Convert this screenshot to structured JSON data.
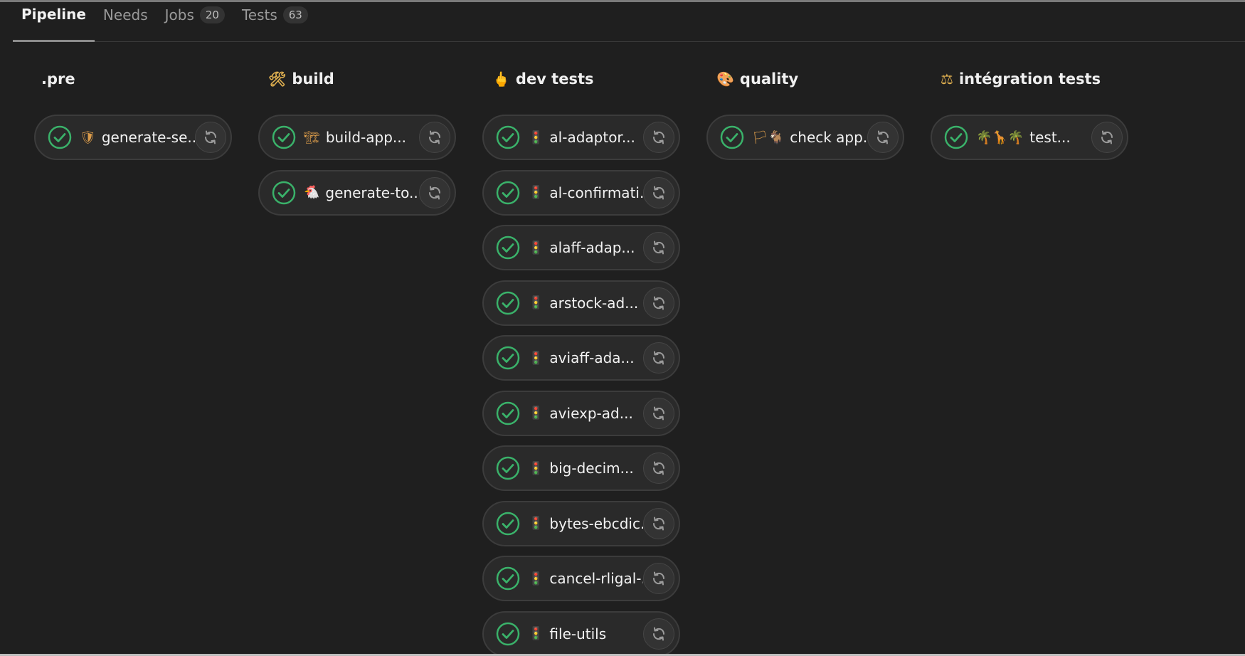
{
  "tabs": [
    {
      "label": "Pipeline",
      "count": ""
    },
    {
      "label": "Needs",
      "count": ""
    },
    {
      "label": "Jobs",
      "count": "20"
    },
    {
      "label": "Tests",
      "count": "63"
    }
  ],
  "colors": {
    "success": "#3ab26a",
    "background": "#1f1f1f",
    "job_pill": "#2a2a2a"
  },
  "icons": {
    "status": "check-circle-icon",
    "retry": "retry-icon"
  },
  "stages": [
    {
      "title": ".pre",
      "emoji": "",
      "jobs": [
        {
          "emoji": "🛡",
          "name": "generate-se..."
        }
      ]
    },
    {
      "title": "build",
      "emoji": "🛠",
      "jobs": [
        {
          "emoji": "🏗",
          "name": "build-app..."
        },
        {
          "emoji": "🐔",
          "name": "generate-to..."
        }
      ]
    },
    {
      "title": "dev tests",
      "emoji": "🖕",
      "jobs": [
        {
          "emoji": "🚦",
          "name": "al-adaptor..."
        },
        {
          "emoji": "🚦",
          "name": "al-confirmati..."
        },
        {
          "emoji": "🚦",
          "name": "alaff-adap..."
        },
        {
          "emoji": "🚦",
          "name": "arstock-ad..."
        },
        {
          "emoji": "🚦",
          "name": "aviaff-ada..."
        },
        {
          "emoji": "🚦",
          "name": "aviexp-ad..."
        },
        {
          "emoji": "🚦",
          "name": "big-decim..."
        },
        {
          "emoji": "🚦",
          "name": "bytes-ebcdic..."
        },
        {
          "emoji": "🚦",
          "name": "cancel-rligal-..."
        },
        {
          "emoji": "🚦",
          "name": "file-utils"
        }
      ]
    },
    {
      "title": "quality",
      "emoji": "🎨",
      "jobs": [
        {
          "emoji": "🏳🐐",
          "name": "check app..."
        }
      ]
    },
    {
      "title": "intégration tests",
      "emoji": "⚖",
      "jobs": [
        {
          "emoji": "🌴🦒🌴",
          "name": "test..."
        }
      ]
    }
  ]
}
